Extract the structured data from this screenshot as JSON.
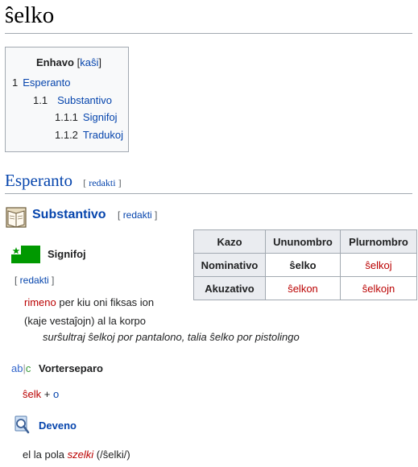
{
  "page": {
    "title": "ŝelko"
  },
  "toc": {
    "title": "Enhavo",
    "hide_label": "kaŝi",
    "items": [
      {
        "num": "1",
        "label": "Esperanto"
      },
      {
        "num": "1.1",
        "label": "Substantivo"
      },
      {
        "num": "1.1.1",
        "label": "Signifoj"
      },
      {
        "num": "1.1.2",
        "label": "Tradukoj"
      }
    ]
  },
  "section": {
    "heading": "Esperanto",
    "edit_label": "redakti"
  },
  "subsection": {
    "heading": "Substantivo",
    "edit_label": "redakti"
  },
  "table": {
    "headers": [
      "Kazo",
      "Ununombro",
      "Plurnombro"
    ],
    "rows": [
      {
        "case": "Nominativo",
        "singular": "ŝelko",
        "plural": "ŝelkoj"
      },
      {
        "case": "Akuzativo",
        "singular": "ŝelkon",
        "plural": "ŝelkojn"
      }
    ]
  },
  "signifoj": {
    "heading": "Signifoj",
    "edit_label": "redakti",
    "definition_link": "rimeno",
    "definition_rest": " per kiu oni fiksas ion",
    "definition_line2": "(kaje vestaĵojn) al la korpo",
    "example": "surŝultraj ŝelkoj por pantalono, talia ŝelko por pistolingo"
  },
  "vorterseparo": {
    "heading": "Vorterseparo",
    "icon_text": [
      "ab",
      "c"
    ],
    "root": "ŝelk",
    "plus": " + ",
    "ending": "o"
  },
  "deveno": {
    "heading": "Deveno",
    "text_before": "el la pola ",
    "source_word": "szelki",
    "text_after": " (/ŝelki/)"
  },
  "colors": {
    "link": "#0645ad",
    "redlink": "#ba0000",
    "flag_green": "#009900"
  },
  "icons": [
    "book-icon",
    "esperanto-flag-icon",
    "abc-hyphenation-icon",
    "magnifier-icon"
  ]
}
